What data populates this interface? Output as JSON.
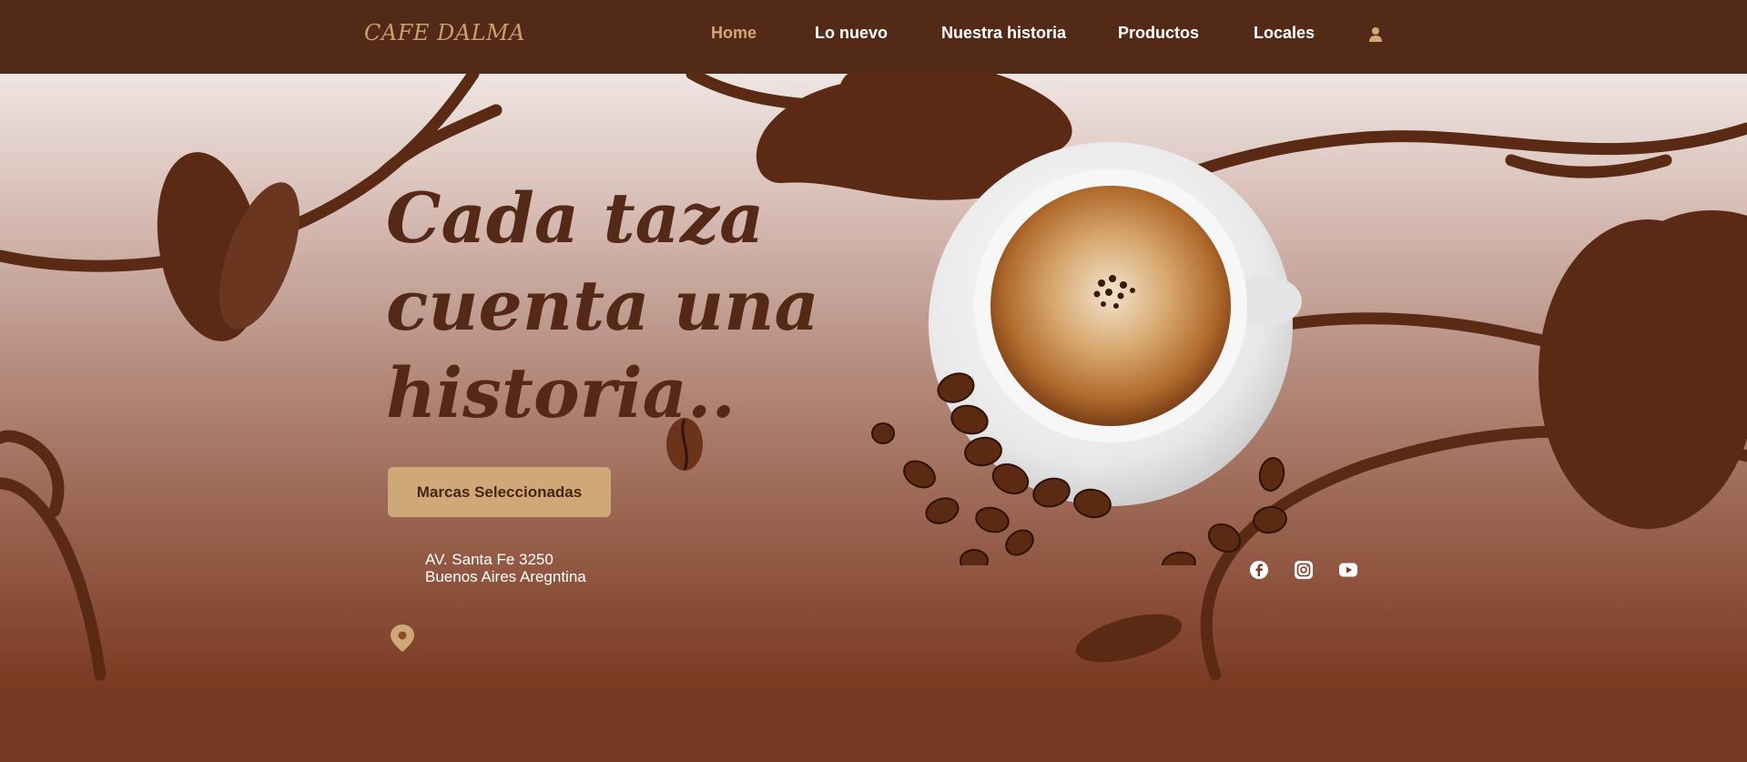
{
  "nav": {
    "logo": "CAFE DALMA",
    "items": [
      {
        "label": "Home",
        "active": true
      },
      {
        "label": "Lo nuevo",
        "active": false
      },
      {
        "label": "Nuestra historia",
        "active": false
      },
      {
        "label": "Productos",
        "active": false
      },
      {
        "label": "Locales",
        "active": false
      }
    ],
    "user_icon": "user-icon"
  },
  "hero": {
    "headline_lines": [
      "Cada taza",
      "cuenta una",
      "historia.."
    ],
    "cta_label": "Marcas Seleccionadas",
    "image": "coffee-cup-with-beans"
  },
  "location": {
    "icon": "map-pin-icon",
    "line1": "AV. Santa Fe 3250",
    "line2": "Buenos Aires Aregntina"
  },
  "social": [
    {
      "icon": "facebook-icon"
    },
    {
      "icon": "instagram-icon"
    },
    {
      "icon": "youtube-icon"
    }
  ],
  "colors": {
    "nav_bg": "#532a18",
    "accent": "#cea876",
    "headline": "#552917",
    "decor": "#5a2a15",
    "footer": "#753a22"
  }
}
